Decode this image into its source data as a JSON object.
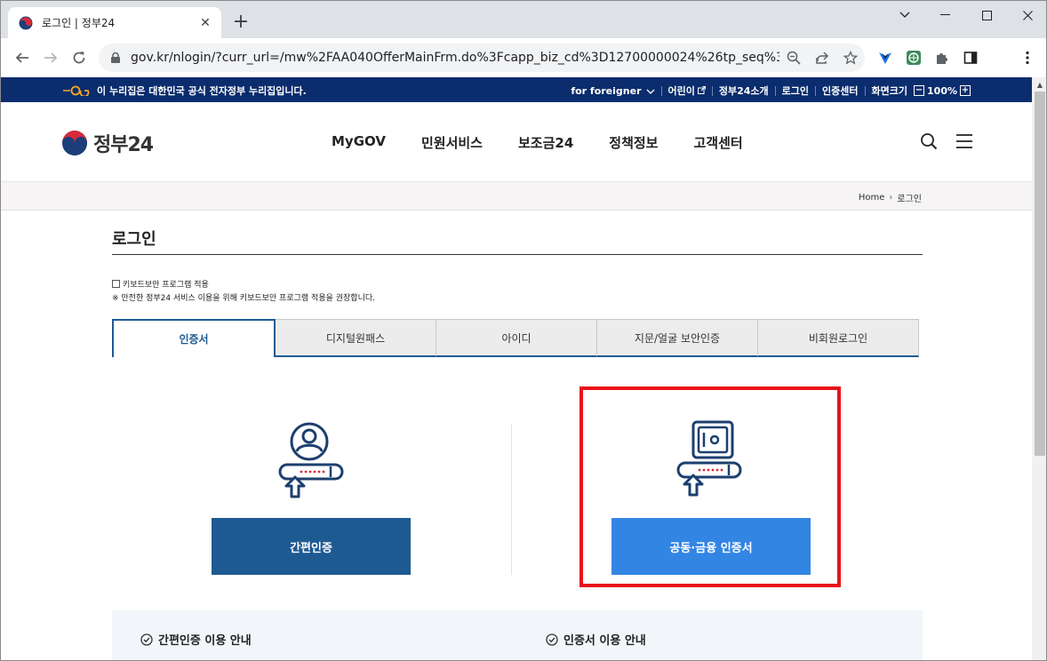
{
  "browser": {
    "tab_title": "로그인 | 정부24",
    "new_tab": "+",
    "url": "gov.kr/nlogin/?curr_url=/mw%2FAA040OfferMainFrm.do%3Fcapp_biz_cd%3D12700000024%26tp_seq%3D"
  },
  "gov_banner": {
    "notice": "이 누리집은 대한민국 공식 전자정부 누리집입니다.",
    "links": [
      "for foreigner",
      "어린이",
      "정부24소개",
      "로그인",
      "인증센터"
    ],
    "zoom_label": "화면크기",
    "zoom_minus": "−",
    "zoom_value": "100%",
    "zoom_plus": "+"
  },
  "header": {
    "logo_text": "정부24",
    "nav": [
      "MyGOV",
      "민원서비스",
      "보조금24",
      "정책정보",
      "고객센터"
    ]
  },
  "breadcrumb": {
    "home": "Home",
    "chevron": "›",
    "current": "로그인"
  },
  "login": {
    "title": "로그인",
    "keyboard_security_label": "키보드보안 프로그램 적용",
    "keyboard_security_note": "※ 안전한 정부24 서비스 이용을 위해 키보드보안 프로그램 적용을 권장합니다.",
    "tabs": [
      "인증서",
      "디지털원패스",
      "아이디",
      "지문/얼굴 보안인증",
      "비회원로그인"
    ],
    "active_tab": 0,
    "simple_auth_button": "간편인증",
    "joint_cert_button": "공동·금융 인증서",
    "simple_auth_guide": "간편인증 이용 안내",
    "cert_guide": "인증서 이용 안내"
  },
  "colors": {
    "gov_banner_bg": "#0b2d6d",
    "simple_button": "#1e5a92",
    "joint_button": "#3385e4",
    "highlight": "#e8131a"
  }
}
